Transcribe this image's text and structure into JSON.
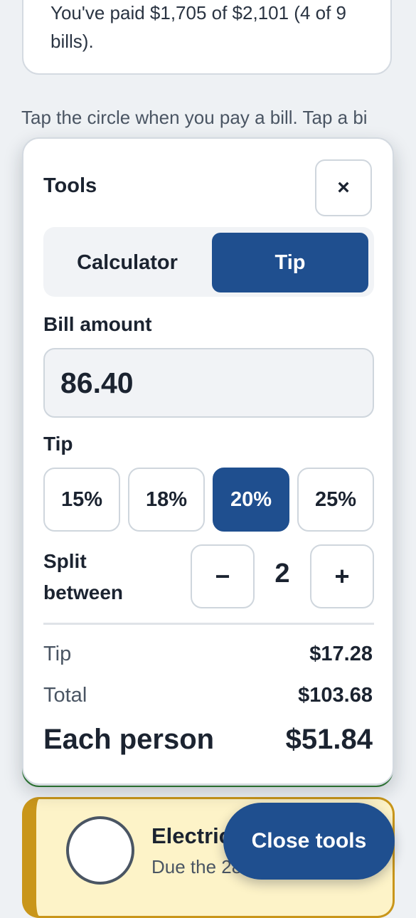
{
  "summary": {
    "text": "You've paid $1,705 of $2,101 (4 of 9 bills)."
  },
  "hint": "Tap the circle when you pay a bill. Tap a bi",
  "bill_card": {
    "name": "Electric",
    "due": "Due the 28"
  },
  "tools_panel": {
    "title": "Tools",
    "close_symbol": "×",
    "tabs": [
      {
        "label": "Calculator",
        "selected": false
      },
      {
        "label": "Tip",
        "selected": true
      }
    ],
    "bill_amount_label": "Bill amount",
    "bill_amount_value": "86.40",
    "tip_label": "Tip",
    "tip_options": [
      {
        "label": "15%",
        "selected": false
      },
      {
        "label": "18%",
        "selected": false
      },
      {
        "label": "20%",
        "selected": true
      },
      {
        "label": "25%",
        "selected": false
      }
    ],
    "split_label": "Split between",
    "split_minus": "−",
    "split_value": "2",
    "split_plus": "+",
    "results": {
      "tip_label": "Tip",
      "tip_value": "$17.28",
      "total_label": "Total",
      "total_value": "$103.68",
      "each_label": "Each person",
      "each_value": "$51.84"
    }
  },
  "close_tools_label": "Close tools",
  "colors": {
    "accent": "#1f4f8f",
    "background": "#eef1f4",
    "bill_card_bg": "#fdf3c8",
    "bill_card_border": "#c9961a",
    "paid_border": "#2e7d32"
  }
}
